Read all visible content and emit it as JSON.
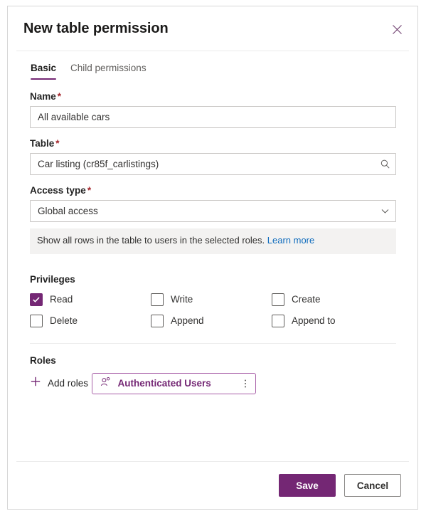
{
  "dialog": {
    "title": "New table permission",
    "close_icon": "close-icon"
  },
  "tabs": [
    {
      "label": "Basic",
      "active": true
    },
    {
      "label": "Child permissions",
      "active": false
    }
  ],
  "form": {
    "name": {
      "label": "Name",
      "required": "*",
      "value": "All available cars"
    },
    "table": {
      "label": "Table",
      "required": "*",
      "value": "Car listing (cr85f_carlistings)",
      "icon": "search-icon"
    },
    "access_type": {
      "label": "Access type",
      "required": "*",
      "value": "Global access",
      "icon": "chevron-down-icon"
    },
    "info": {
      "text": "Show all rows in the table to users in the selected roles.",
      "link": "Learn more"
    }
  },
  "privileges": {
    "title": "Privileges",
    "items": [
      {
        "label": "Read",
        "checked": true
      },
      {
        "label": "Write",
        "checked": false
      },
      {
        "label": "Create",
        "checked": false
      },
      {
        "label": "Delete",
        "checked": false
      },
      {
        "label": "Append",
        "checked": false
      },
      {
        "label": "Append to",
        "checked": false
      }
    ]
  },
  "roles": {
    "title": "Roles",
    "add_label": "Add roles",
    "add_icon": "plus-icon",
    "chips": [
      {
        "label": "Authenticated Users",
        "icon": "person-icon",
        "menu_icon": "more-vertical-icon"
      }
    ]
  },
  "footer": {
    "save_label": "Save",
    "cancel_label": "Cancel"
  },
  "colors": {
    "accent": "#742774",
    "link": "#0f6cbd",
    "required": "#a4262c",
    "banner_bg": "#f3f2f1"
  }
}
